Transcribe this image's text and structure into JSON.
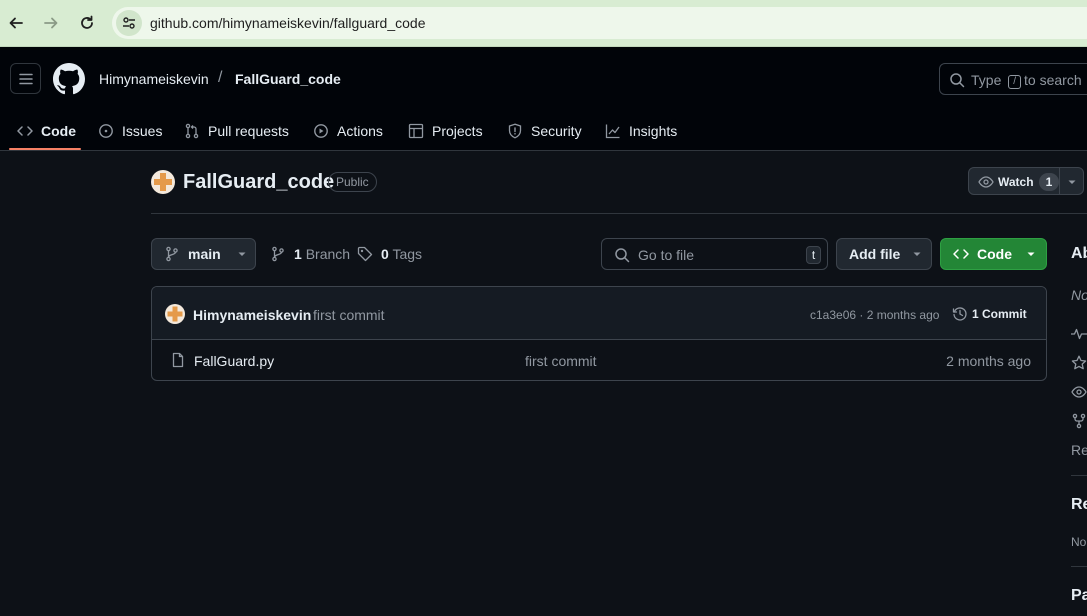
{
  "browser": {
    "url": "github.com/himynameiskevin/fallguard_code"
  },
  "header": {
    "owner": "Himynameiskevin",
    "separator": "/",
    "repo": "FallGuard_code",
    "search": {
      "prefix": "Type",
      "key": "/",
      "suffix": "to search"
    }
  },
  "tabs": [
    {
      "label": "Code",
      "icon": "code-icon",
      "active": true
    },
    {
      "label": "Issues",
      "icon": "issue-opened-icon"
    },
    {
      "label": "Pull requests",
      "icon": "git-pull-request-icon"
    },
    {
      "label": "Actions",
      "icon": "play-icon"
    },
    {
      "label": "Projects",
      "icon": "table-icon"
    },
    {
      "label": "Security",
      "icon": "shield-icon"
    },
    {
      "label": "Insights",
      "icon": "graph-icon"
    }
  ],
  "repo": {
    "name": "FallGuard_code",
    "visibility": "Public",
    "watch": {
      "label": "Watch",
      "count": "1"
    }
  },
  "toolbar": {
    "branch": "main",
    "branches": {
      "count": "1",
      "label": "Branch"
    },
    "tags": {
      "count": "0",
      "label": "Tags"
    },
    "goto_placeholder": "Go to file",
    "goto_key": "t",
    "add_file": "Add file",
    "code": "Code"
  },
  "commit": {
    "author": "Himynameiskevin",
    "message": "first commit",
    "hash_time": "c1a3e06 · 2 months ago",
    "count_label": "1 Commit"
  },
  "files": [
    {
      "name": "FallGuard.py",
      "message": "first commit",
      "time": "2 months ago"
    }
  ],
  "sidebar": {
    "about_heading": "Ab",
    "about_text": "No",
    "readme_short": "Re",
    "releases_heading": "Re",
    "releases_text": "No",
    "packages_heading": "Pa"
  },
  "colors": {
    "bg": "#0d1117",
    "header_bg": "#010409",
    "border": "#3d444d",
    "accent_underline": "#f78166",
    "green_button": "#238636",
    "browser_chrome": "#d8ecd2"
  }
}
